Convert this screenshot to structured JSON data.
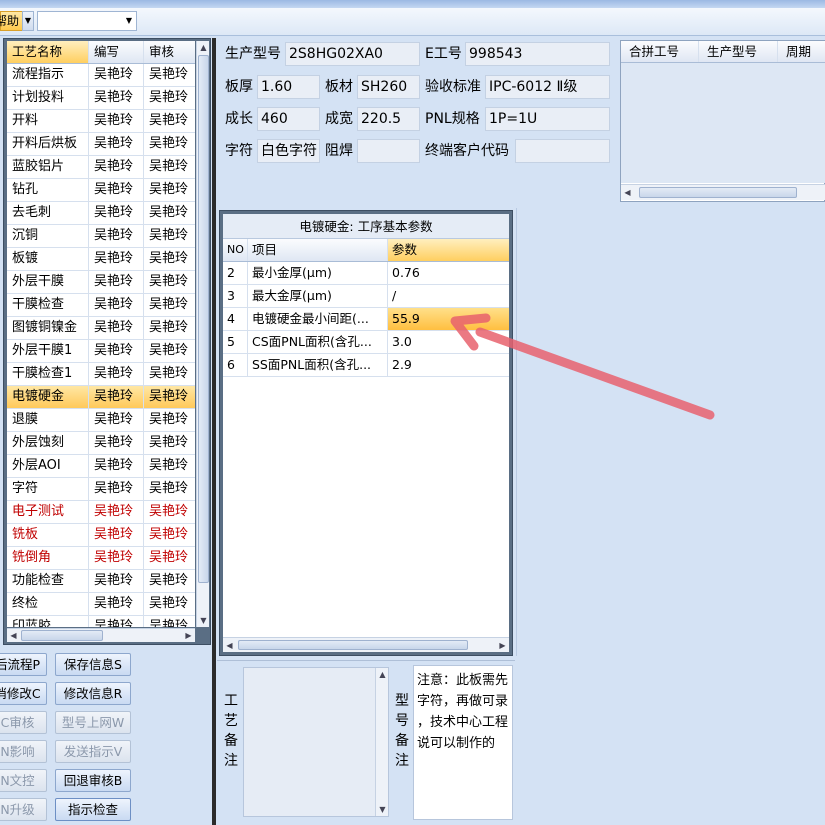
{
  "menu": {
    "help_label": "帮助",
    "combo_value": ""
  },
  "process_list": {
    "headers": [
      "工艺名称",
      "编写",
      "审核"
    ],
    "rows": [
      {
        "name": "流程指示",
        "writer": "吴艳玲",
        "reviewer": "吴艳玲"
      },
      {
        "name": "计划投料",
        "writer": "吴艳玲",
        "reviewer": "吴艳玲"
      },
      {
        "name": "开料",
        "writer": "吴艳玲",
        "reviewer": "吴艳玲"
      },
      {
        "name": "开料后烘板",
        "writer": "吴艳玲",
        "reviewer": "吴艳玲"
      },
      {
        "name": "蓝胶铝片",
        "writer": "吴艳玲",
        "reviewer": "吴艳玲"
      },
      {
        "name": "钻孔",
        "writer": "吴艳玲",
        "reviewer": "吴艳玲"
      },
      {
        "name": "去毛刺",
        "writer": "吴艳玲",
        "reviewer": "吴艳玲"
      },
      {
        "name": "沉铜",
        "writer": "吴艳玲",
        "reviewer": "吴艳玲"
      },
      {
        "name": "板镀",
        "writer": "吴艳玲",
        "reviewer": "吴艳玲"
      },
      {
        "name": "外层干膜",
        "writer": "吴艳玲",
        "reviewer": "吴艳玲"
      },
      {
        "name": "干膜检查",
        "writer": "吴艳玲",
        "reviewer": "吴艳玲"
      },
      {
        "name": "图镀铜镍金",
        "writer": "吴艳玲",
        "reviewer": "吴艳玲"
      },
      {
        "name": "外层干膜1",
        "writer": "吴艳玲",
        "reviewer": "吴艳玲"
      },
      {
        "name": "干膜检查1",
        "writer": "吴艳玲",
        "reviewer": "吴艳玲"
      },
      {
        "name": "电镀硬金",
        "writer": "吴艳玲",
        "reviewer": "吴艳玲"
      },
      {
        "name": "退膜",
        "writer": "吴艳玲",
        "reviewer": "吴艳玲"
      },
      {
        "name": "外层蚀刻",
        "writer": "吴艳玲",
        "reviewer": "吴艳玲"
      },
      {
        "name": "外层AOI",
        "writer": "吴艳玲",
        "reviewer": "吴艳玲"
      },
      {
        "name": "字符",
        "writer": "吴艳玲",
        "reviewer": "吴艳玲"
      },
      {
        "name": "电子测试",
        "writer": "吴艳玲",
        "reviewer": "吴艳玲"
      },
      {
        "name": "铣板",
        "writer": "吴艳玲",
        "reviewer": "吴艳玲"
      },
      {
        "name": "铣倒角",
        "writer": "吴艳玲",
        "reviewer": "吴艳玲"
      },
      {
        "name": "功能检查",
        "writer": "吴艳玲",
        "reviewer": "吴艳玲"
      },
      {
        "name": "终检",
        "writer": "吴艳玲",
        "reviewer": "吴艳玲"
      },
      {
        "name": "印蓝胶",
        "writer": "吴艳玲",
        "reviewer": "吴艳玲"
      }
    ],
    "selected_index": 14,
    "red_indices": [
      19,
      20,
      21
    ],
    "red_color": "#c00000"
  },
  "buttons": {
    "flow": "后流程P",
    "save": "保存信息S",
    "cancel_edit": "消修改C",
    "edit": "修改信息R",
    "review": "C审核",
    "model_online": "型号上网W",
    "impact": "N影响",
    "send": "发送指示V",
    "doc_control": "N文控",
    "reject": "回退审核B",
    "upgrade": "N升级",
    "check": "指示检查"
  },
  "info": {
    "model_label": "生产型号",
    "model_value": "2S8HG02XA0",
    "eno_label": "E工号",
    "eno_value": "998543",
    "thickness_label": "板厚",
    "thickness_value": "1.60",
    "material_label": "板材",
    "material_value": "SH260",
    "standard_label": "验收标准",
    "standard_value": "IPC-6012 Ⅱ级",
    "length_label": "成长",
    "length_value": "460",
    "width_label": "成宽",
    "width_value": "220.5",
    "pnl_label": "PNL规格",
    "pnl_value": "1P=1U",
    "char_label": "字符",
    "char_value": "白色字符",
    "mask_label": "阻焊",
    "mask_value": "",
    "customer_label": "终端客户代码",
    "customer_value": ""
  },
  "merge": {
    "headers": [
      "合拼工号",
      "生产型号",
      "周期"
    ]
  },
  "params": {
    "title": "电镀硬金: 工序基本参数",
    "headers": [
      "NO",
      "项目",
      "参数"
    ],
    "rows": [
      {
        "no": "2",
        "item": "最小金厚(μm)",
        "value": "0.76"
      },
      {
        "no": "3",
        "item": "最大金厚(μm)",
        "value": "/"
      },
      {
        "no": "4",
        "item": "电镀硬金最小间距(...",
        "value": "55.9"
      },
      {
        "no": "5",
        "item": "CS面PNL面积(含孔...",
        "value": "3.0"
      },
      {
        "no": "6",
        "item": "SS面PNL面积(含孔...",
        "value": "2.9"
      }
    ],
    "selected_index": 2
  },
  "notes": {
    "process_label": "工艺备注",
    "model_label": "型号备注",
    "model_note_lines": [
      "注意：此板需先",
      "字符，再做可录",
      "，技术中心工程",
      "说可以制作的"
    ]
  },
  "annotation": {
    "arrow_color": "#e8626e"
  }
}
